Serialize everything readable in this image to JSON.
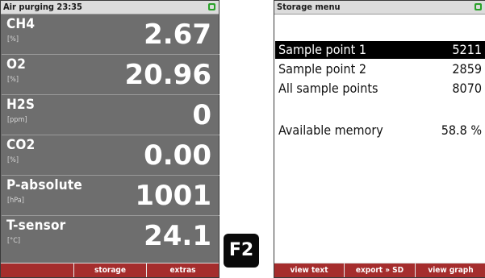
{
  "left_screen": {
    "title": "Air purging 23:35",
    "measurements": [
      {
        "name": "CH4",
        "unit": "[%]",
        "value": "2.67"
      },
      {
        "name": "O2",
        "unit": "[%]",
        "value": "20.96"
      },
      {
        "name": "H2S",
        "unit": "[ppm]",
        "value": "0"
      },
      {
        "name": "CO2",
        "unit": "[%]",
        "value": "0.00"
      },
      {
        "name": "P-absolute",
        "unit": "[hPa]",
        "value": "1001"
      },
      {
        "name": "T-sensor",
        "unit": "[°C]",
        "value": "24.1"
      }
    ],
    "softkeys": [
      "",
      "storage",
      "extras"
    ]
  },
  "key_label": "F2",
  "right_screen": {
    "title": "Storage menu",
    "items": [
      {
        "label": "Sample point 1",
        "value": "5211",
        "selected": true
      },
      {
        "label": "Sample point 2",
        "value": "2859",
        "selected": false
      },
      {
        "label": "All sample points",
        "value": "8070",
        "selected": false
      }
    ],
    "memory": {
      "label": "Available memory",
      "value": "58.8 %"
    },
    "softkeys": [
      "view text",
      "export » SD",
      "view graph"
    ]
  },
  "colors": {
    "battery": "#2aa12a",
    "softkey_bar": "#a52d2d",
    "measure_bg": "#6e6e6e"
  }
}
